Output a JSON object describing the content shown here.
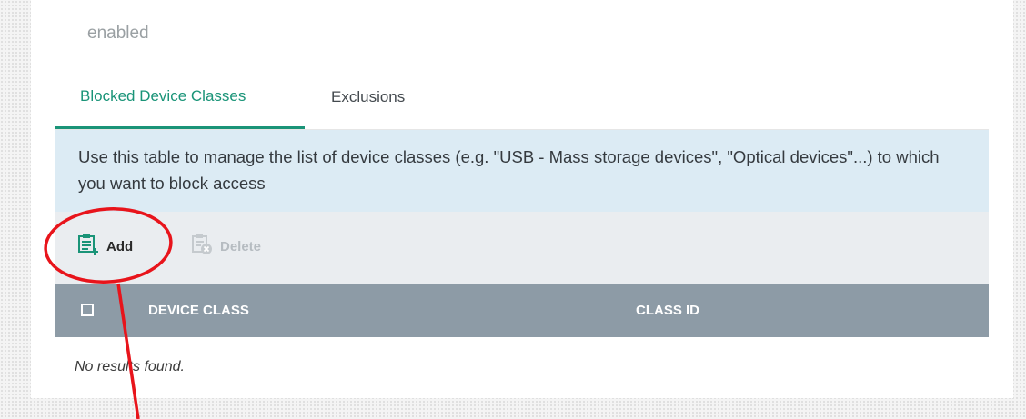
{
  "header": {
    "status_text": "enabled"
  },
  "tabs": [
    {
      "label": "Blocked Device Classes",
      "active": true
    },
    {
      "label": "Exclusions",
      "active": false
    }
  ],
  "info": {
    "text": "Use this table to manage the list of device classes (e.g. \"USB - Mass storage devices\", \"Optical devices\"...) to which you want to block access"
  },
  "toolbar": {
    "add_label": "Add",
    "add_icon": "add-list-icon",
    "delete_label": "Delete",
    "delete_icon": "delete-list-icon",
    "delete_enabled": false
  },
  "table": {
    "columns": [
      "DEVICE CLASS",
      "CLASS ID"
    ],
    "empty_message": "No results found."
  },
  "annotation": {
    "color": "#e8141b",
    "shape": "ellipse-with-arrow",
    "target": "add-button"
  },
  "colors": {
    "accent": "#1a9478",
    "table_header": "#8d9ba6",
    "info_background": "#dcebf4",
    "toolbar_background": "#eaedf0"
  }
}
